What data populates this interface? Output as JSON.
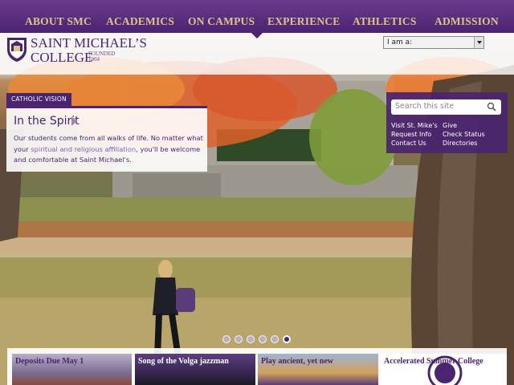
{
  "nav": {
    "items": [
      "ABOUT SMC",
      "ACADEMICS",
      "ON CAMPUS",
      "EXPERIENCE",
      "ATHLETICS",
      "ADMISSION"
    ]
  },
  "brand": {
    "name_line1": "SAINT MICHAEL’S",
    "name_line2": "COLLEGE",
    "founded": "FOUNDED",
    "year": "1904"
  },
  "audience_select": {
    "value": "I am a:"
  },
  "feature": {
    "tag": "CATHOLIC VISION",
    "title": "In the Spirit",
    "text_before": "Our students come from all walks of life. No matter what your ",
    "link": "spiritual and religious affiliation",
    "text_after": ", you'll be welcome and comfortable at Saint Michael's."
  },
  "search": {
    "placeholder": "Search this site",
    "icon": "search-icon"
  },
  "quick_links": {
    "left": [
      "Visit St. Mike's",
      "Request Info",
      "Contact Us"
    ],
    "right": [
      "Give",
      "Check Status",
      "Directories"
    ]
  },
  "slider": {
    "count": 6,
    "active": 6
  },
  "cards": [
    {
      "label": "Deposits Due May 1"
    },
    {
      "label": "Song of the Volga jazzman"
    },
    {
      "label": "Play ancient, yet new"
    },
    {
      "label": "Accelerated Summer College"
    }
  ],
  "colors": {
    "purple": "#4b2470",
    "gold": "#d9c58a",
    "white": "#ffffff"
  }
}
